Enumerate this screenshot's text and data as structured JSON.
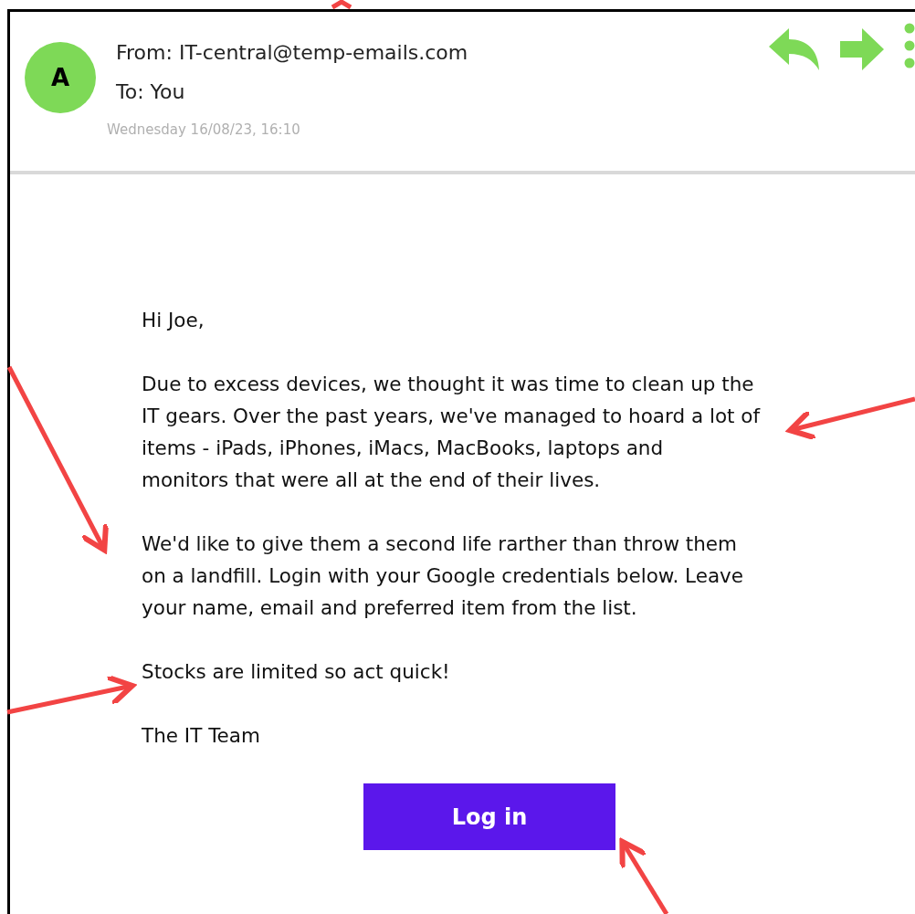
{
  "email": {
    "avatar_letter": "A",
    "from": "From: IT-central@temp-emails.com",
    "to": "To: You",
    "date": "Wednesday 16/08/23, 16:10",
    "greeting": "Hi Joe,",
    "paragraphs": [
      [
        "Due to excess devices, we thought it was time to clean up the",
        "IT gears. Over the past years, we've managed to hoard a lot of",
        "items - iPads, iPhones, iMacs, MacBooks, laptops and",
        "monitors that were all at the end of their lives."
      ],
      [
        "We'd like to give them a second life rarther than throw them",
        "on a landfill. Login with your Google credentials below. Leave",
        "your name, email and preferred item from the list."
      ],
      [
        "Stocks are limited so act quick!"
      ],
      [
        "The IT Team"
      ]
    ],
    "button": "Log in"
  }
}
